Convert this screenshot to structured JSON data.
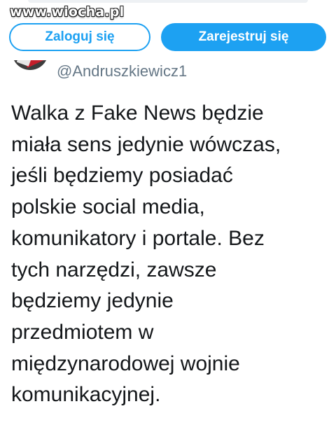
{
  "watermark": "www.wiocha.pl",
  "auth": {
    "login_label": "Zaloguj się",
    "register_label": "Zarejestruj się"
  },
  "author": {
    "handle": "@Andruszkiewicz1"
  },
  "tweet": {
    "lines": [
      "Walka z Fake News będzie",
      "miała sens jedynie wówczas,",
      "jeśli będziemy posiadać",
      "polskie social media,",
      "komunikatory i portale. Bez",
      "tych narzędzi, zawsze",
      "będziemy jedynie",
      "przedmiotem w",
      "międzynarodowej wojnie",
      "komunikacyjnej."
    ]
  },
  "colors": {
    "accent": "#1da1f2",
    "text": "#14171a",
    "muted": "#657786"
  }
}
